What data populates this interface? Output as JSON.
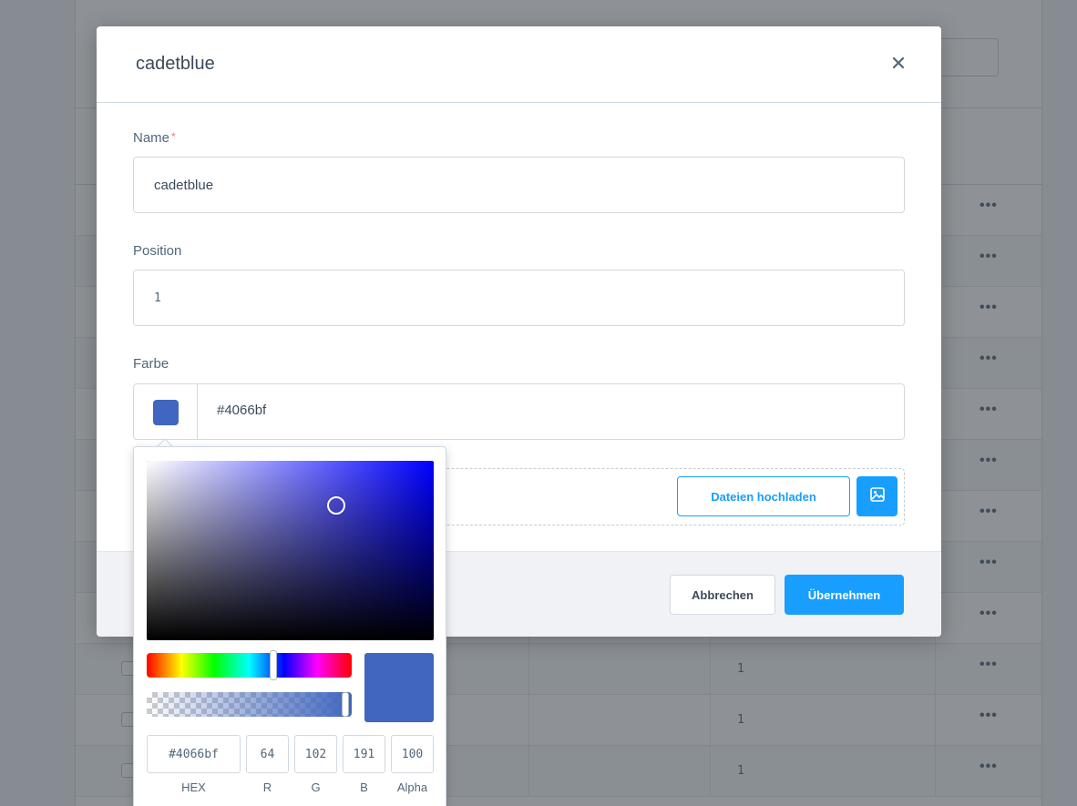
{
  "modal": {
    "title": "cadetblue",
    "close_icon": "close-icon",
    "fields": {
      "name_label": "Name",
      "name_required_mark": "*",
      "name_value": "cadetblue",
      "position_label": "Position",
      "position_value": "1",
      "color_label": "Farbe",
      "color_value": "#4066bf"
    },
    "upload": {
      "button_label": "Dateien hochladen",
      "image_icon": "image-icon"
    },
    "footer": {
      "cancel_label": "Abbrechen",
      "apply_label": "Übernehmen"
    }
  },
  "color_picker": {
    "hex": "#4066bf",
    "r": "64",
    "g": "102",
    "b": "191",
    "alpha": "100",
    "labels": {
      "hex": "HEX",
      "r": "R",
      "g": "G",
      "b": "B",
      "alpha": "Alpha"
    },
    "hue_value": 222,
    "saturation": 0.66,
    "brightness": 0.75,
    "alpha_fraction": 1.0
  },
  "background_table": {
    "rows": [
      {
        "position": "",
        "menu": "•••"
      },
      {
        "position": "",
        "menu": "•••"
      },
      {
        "position": "",
        "menu": "•••"
      },
      {
        "position": "",
        "menu": "•••"
      },
      {
        "position": "",
        "menu": "•••"
      },
      {
        "position": "",
        "menu": "•••"
      },
      {
        "position": "",
        "menu": "•••"
      },
      {
        "position": "",
        "menu": "•••"
      },
      {
        "position": "",
        "menu": "•••"
      },
      {
        "position": "1",
        "menu": "•••"
      },
      {
        "position": "1",
        "menu": "•••"
      },
      {
        "position": "1",
        "menu": "•••"
      }
    ]
  },
  "colors": {
    "accent": "#189eff",
    "selected_color": "#4066bf",
    "hue_color": "#0000ff"
  }
}
